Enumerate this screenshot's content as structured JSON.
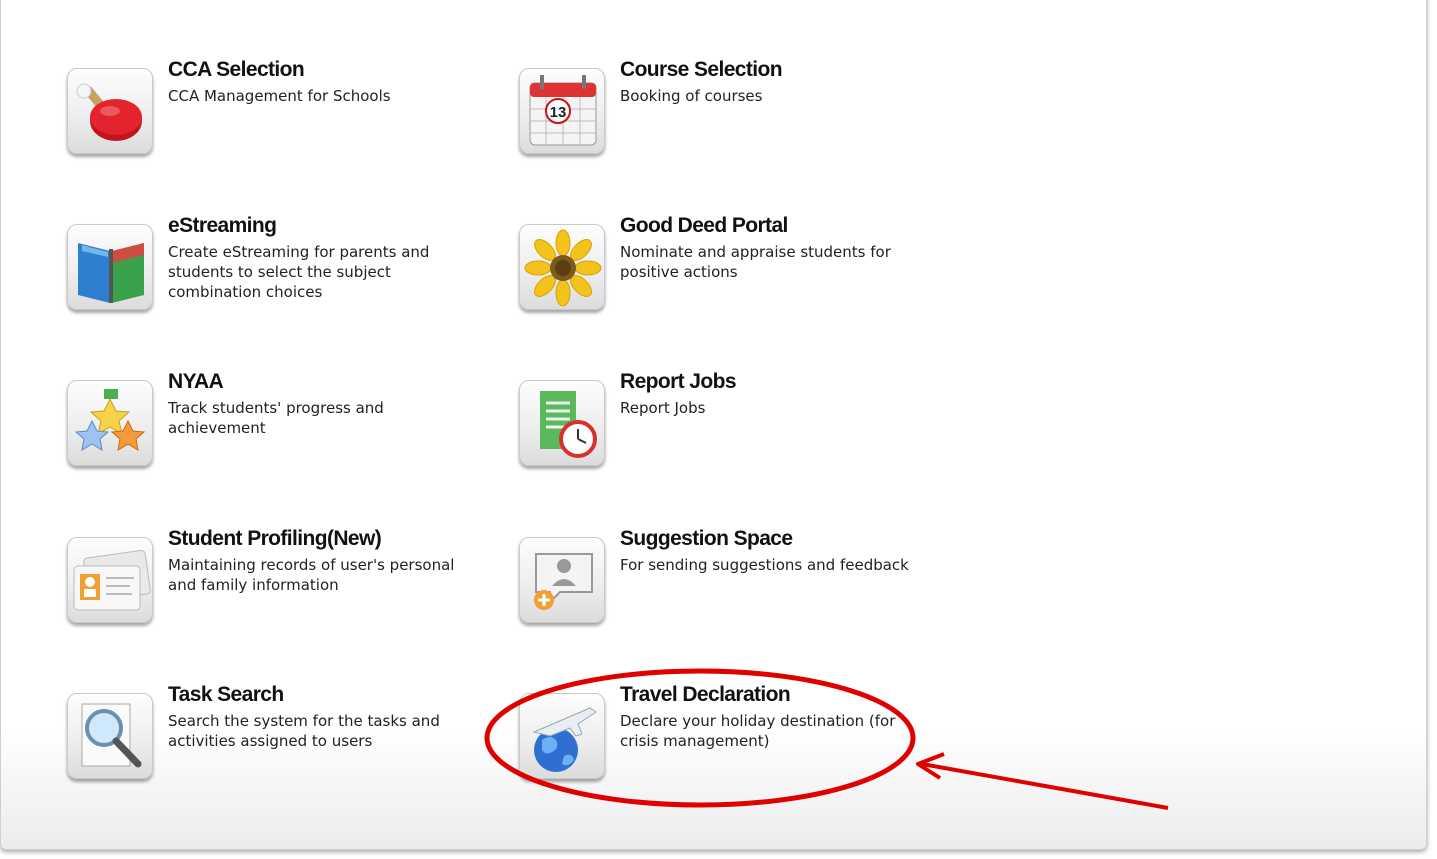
{
  "apps": [
    {
      "title": "CCA Selection",
      "description": "CCA Management for Schools",
      "icon": "ping-pong-paddle-icon"
    },
    {
      "title": "Course Selection",
      "description": "Booking of courses",
      "icon": "calendar-icon",
      "calendar_day": "13"
    },
    {
      "title": "eStreaming",
      "description": "Create eStreaming for parents and students to select the subject combination choices",
      "icon": "open-book-icon"
    },
    {
      "title": "Good Deed Portal",
      "description": "Nominate and appraise students for positive actions",
      "icon": "sunflower-icon"
    },
    {
      "title": "NYAA",
      "description": "Track students' progress and achievement",
      "icon": "stars-icon"
    },
    {
      "title": "Report Jobs",
      "description": "Report Jobs",
      "icon": "report-clock-icon"
    },
    {
      "title": "Student Profiling(New)",
      "description": "Maintaining records of user's personal and family information",
      "icon": "id-cards-icon"
    },
    {
      "title": "Suggestion Space",
      "description": "For sending suggestions and feedback",
      "icon": "speech-bubble-user-icon"
    },
    {
      "title": "Task Search",
      "description": "Search the system for the tasks and activities assigned to users",
      "icon": "magnifier-icon"
    },
    {
      "title": "Travel Declaration",
      "description": "Declare your holiday destination (for crisis management)",
      "icon": "globe-airplane-icon"
    }
  ],
  "annotation": {
    "color": "#e00000",
    "shapes": [
      "ellipse-highlight",
      "arrow"
    ]
  }
}
